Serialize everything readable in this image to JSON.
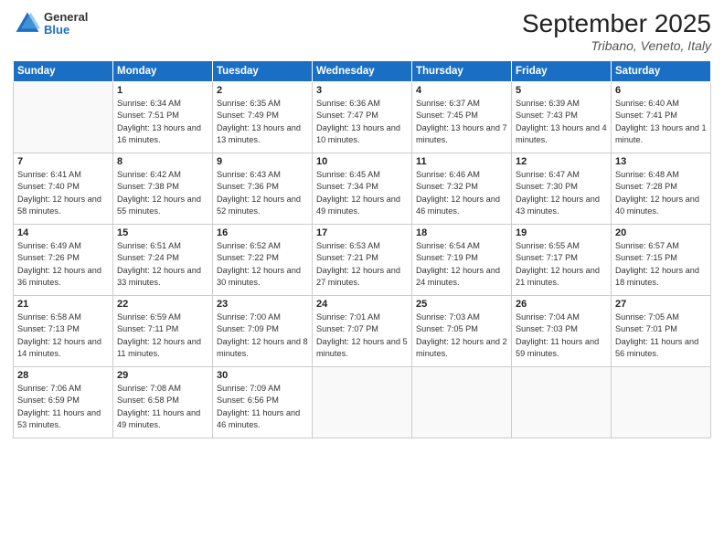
{
  "header": {
    "logo_general": "General",
    "logo_blue": "Blue",
    "month_title": "September 2025",
    "location": "Tribano, Veneto, Italy"
  },
  "days_of_week": [
    "Sunday",
    "Monday",
    "Tuesday",
    "Wednesday",
    "Thursday",
    "Friday",
    "Saturday"
  ],
  "weeks": [
    [
      {
        "day": "",
        "empty": true
      },
      {
        "day": "1",
        "sunrise": "Sunrise: 6:34 AM",
        "sunset": "Sunset: 7:51 PM",
        "daylight": "Daylight: 13 hours and 16 minutes."
      },
      {
        "day": "2",
        "sunrise": "Sunrise: 6:35 AM",
        "sunset": "Sunset: 7:49 PM",
        "daylight": "Daylight: 13 hours and 13 minutes."
      },
      {
        "day": "3",
        "sunrise": "Sunrise: 6:36 AM",
        "sunset": "Sunset: 7:47 PM",
        "daylight": "Daylight: 13 hours and 10 minutes."
      },
      {
        "day": "4",
        "sunrise": "Sunrise: 6:37 AM",
        "sunset": "Sunset: 7:45 PM",
        "daylight": "Daylight: 13 hours and 7 minutes."
      },
      {
        "day": "5",
        "sunrise": "Sunrise: 6:39 AM",
        "sunset": "Sunset: 7:43 PM",
        "daylight": "Daylight: 13 hours and 4 minutes."
      },
      {
        "day": "6",
        "sunrise": "Sunrise: 6:40 AM",
        "sunset": "Sunset: 7:41 PM",
        "daylight": "Daylight: 13 hours and 1 minute."
      }
    ],
    [
      {
        "day": "7",
        "sunrise": "Sunrise: 6:41 AM",
        "sunset": "Sunset: 7:40 PM",
        "daylight": "Daylight: 12 hours and 58 minutes."
      },
      {
        "day": "8",
        "sunrise": "Sunrise: 6:42 AM",
        "sunset": "Sunset: 7:38 PM",
        "daylight": "Daylight: 12 hours and 55 minutes."
      },
      {
        "day": "9",
        "sunrise": "Sunrise: 6:43 AM",
        "sunset": "Sunset: 7:36 PM",
        "daylight": "Daylight: 12 hours and 52 minutes."
      },
      {
        "day": "10",
        "sunrise": "Sunrise: 6:45 AM",
        "sunset": "Sunset: 7:34 PM",
        "daylight": "Daylight: 12 hours and 49 minutes."
      },
      {
        "day": "11",
        "sunrise": "Sunrise: 6:46 AM",
        "sunset": "Sunset: 7:32 PM",
        "daylight": "Daylight: 12 hours and 46 minutes."
      },
      {
        "day": "12",
        "sunrise": "Sunrise: 6:47 AM",
        "sunset": "Sunset: 7:30 PM",
        "daylight": "Daylight: 12 hours and 43 minutes."
      },
      {
        "day": "13",
        "sunrise": "Sunrise: 6:48 AM",
        "sunset": "Sunset: 7:28 PM",
        "daylight": "Daylight: 12 hours and 40 minutes."
      }
    ],
    [
      {
        "day": "14",
        "sunrise": "Sunrise: 6:49 AM",
        "sunset": "Sunset: 7:26 PM",
        "daylight": "Daylight: 12 hours and 36 minutes."
      },
      {
        "day": "15",
        "sunrise": "Sunrise: 6:51 AM",
        "sunset": "Sunset: 7:24 PM",
        "daylight": "Daylight: 12 hours and 33 minutes."
      },
      {
        "day": "16",
        "sunrise": "Sunrise: 6:52 AM",
        "sunset": "Sunset: 7:22 PM",
        "daylight": "Daylight: 12 hours and 30 minutes."
      },
      {
        "day": "17",
        "sunrise": "Sunrise: 6:53 AM",
        "sunset": "Sunset: 7:21 PM",
        "daylight": "Daylight: 12 hours and 27 minutes."
      },
      {
        "day": "18",
        "sunrise": "Sunrise: 6:54 AM",
        "sunset": "Sunset: 7:19 PM",
        "daylight": "Daylight: 12 hours and 24 minutes."
      },
      {
        "day": "19",
        "sunrise": "Sunrise: 6:55 AM",
        "sunset": "Sunset: 7:17 PM",
        "daylight": "Daylight: 12 hours and 21 minutes."
      },
      {
        "day": "20",
        "sunrise": "Sunrise: 6:57 AM",
        "sunset": "Sunset: 7:15 PM",
        "daylight": "Daylight: 12 hours and 18 minutes."
      }
    ],
    [
      {
        "day": "21",
        "sunrise": "Sunrise: 6:58 AM",
        "sunset": "Sunset: 7:13 PM",
        "daylight": "Daylight: 12 hours and 14 minutes."
      },
      {
        "day": "22",
        "sunrise": "Sunrise: 6:59 AM",
        "sunset": "Sunset: 7:11 PM",
        "daylight": "Daylight: 12 hours and 11 minutes."
      },
      {
        "day": "23",
        "sunrise": "Sunrise: 7:00 AM",
        "sunset": "Sunset: 7:09 PM",
        "daylight": "Daylight: 12 hours and 8 minutes."
      },
      {
        "day": "24",
        "sunrise": "Sunrise: 7:01 AM",
        "sunset": "Sunset: 7:07 PM",
        "daylight": "Daylight: 12 hours and 5 minutes."
      },
      {
        "day": "25",
        "sunrise": "Sunrise: 7:03 AM",
        "sunset": "Sunset: 7:05 PM",
        "daylight": "Daylight: 12 hours and 2 minutes."
      },
      {
        "day": "26",
        "sunrise": "Sunrise: 7:04 AM",
        "sunset": "Sunset: 7:03 PM",
        "daylight": "Daylight: 11 hours and 59 minutes."
      },
      {
        "day": "27",
        "sunrise": "Sunrise: 7:05 AM",
        "sunset": "Sunset: 7:01 PM",
        "daylight": "Daylight: 11 hours and 56 minutes."
      }
    ],
    [
      {
        "day": "28",
        "sunrise": "Sunrise: 7:06 AM",
        "sunset": "Sunset: 6:59 PM",
        "daylight": "Daylight: 11 hours and 53 minutes."
      },
      {
        "day": "29",
        "sunrise": "Sunrise: 7:08 AM",
        "sunset": "Sunset: 6:58 PM",
        "daylight": "Daylight: 11 hours and 49 minutes."
      },
      {
        "day": "30",
        "sunrise": "Sunrise: 7:09 AM",
        "sunset": "Sunset: 6:56 PM",
        "daylight": "Daylight: 11 hours and 46 minutes."
      },
      {
        "day": "",
        "empty": true
      },
      {
        "day": "",
        "empty": true
      },
      {
        "day": "",
        "empty": true
      },
      {
        "day": "",
        "empty": true
      }
    ]
  ]
}
